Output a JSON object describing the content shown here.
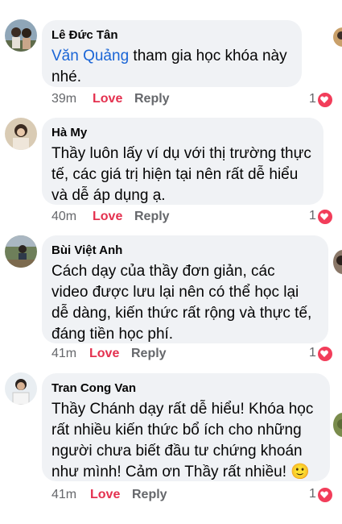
{
  "comments": [
    {
      "author": "Lê Đức Tân",
      "mention": "Văn Quảng",
      "text_line1": " tham gia học khóa này",
      "text_line2": "nhé.",
      "time": "39m",
      "love_label": "Love",
      "reply_label": "Reply",
      "reaction_count": "1"
    },
    {
      "author": "Hà My",
      "text_line1": "Thầy luôn lấy ví dụ với thị trường thực",
      "text_line2": "tế, các giá trị hiện tại nên rất dễ hiểu",
      "text_line3": "và dễ áp dụng ạ.",
      "time": "40m",
      "love_label": "Love",
      "reply_label": "Reply",
      "reaction_count": "1"
    },
    {
      "author": "Bùi Việt Anh",
      "text_line1": " Cách dạy của thầy đơn giản, các",
      "text_line2": "video được lưu lại nên có thể học lại",
      "text_line3": "dễ dàng, kiến thức rất rộng và thực tế,",
      "text_line4": "đáng tiền học phí.",
      "time": "41m",
      "love_label": "Love",
      "reply_label": "Reply",
      "reaction_count": "1"
    },
    {
      "author": "Tran Cong Van",
      "text_line1": "Thầy Chánh dạy rất dễ hiểu! Khóa học",
      "text_line2": "rất nhiều kiến thức bổ ích cho những",
      "text_line3": "người chưa biết đầu tư chứng khoán",
      "text_line4": "như mình! Cảm ơn Thầy rất nhiều! ",
      "emoji": "🙂",
      "time": "41m",
      "love_label": "Love",
      "reply_label": "Reply",
      "reaction_count": "1"
    }
  ],
  "colors": {
    "bubble": "#f0f2f5",
    "love": "#e4314f",
    "mention": "#1a65d6",
    "heart": "#f23d5a"
  }
}
